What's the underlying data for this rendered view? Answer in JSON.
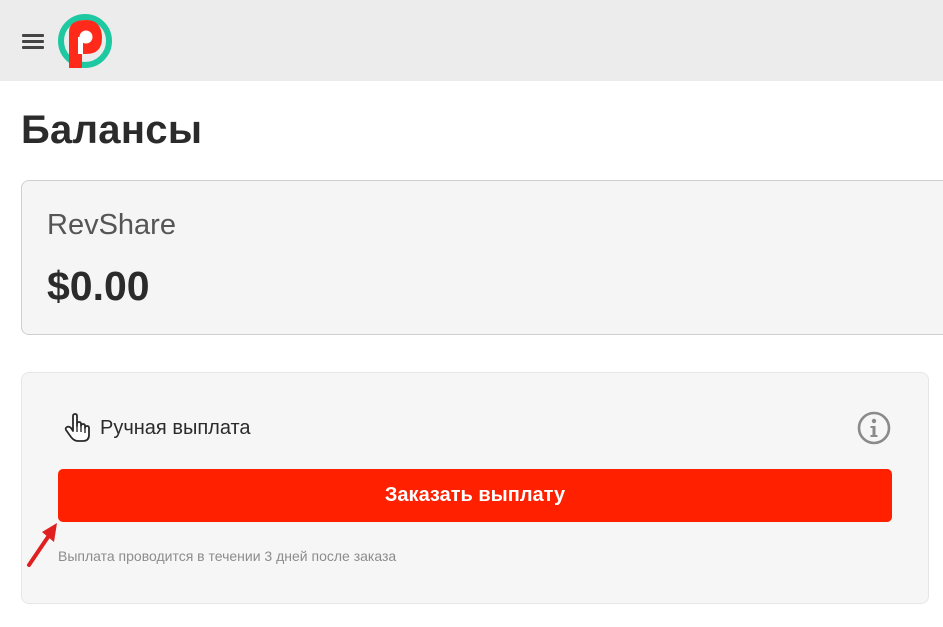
{
  "colors": {
    "accent": "#ff2000",
    "logo_red": "#ff2a1a",
    "logo_teal": "#1ec8a0",
    "annotation_arrow": "#e02020"
  },
  "header": {
    "menu_icon": "hamburger-menu-icon",
    "logo_icon": "p-logo-icon"
  },
  "page": {
    "title": "Балансы"
  },
  "balance": {
    "label": "RevShare",
    "amount": "$0.00"
  },
  "payout": {
    "icon": "pointing-hand-icon",
    "title": "Ручная выплата",
    "info_icon": "info-circle-icon",
    "button_label": "Заказать выплату",
    "note": "Выплата проводится в течении 3 дней после заказа"
  }
}
